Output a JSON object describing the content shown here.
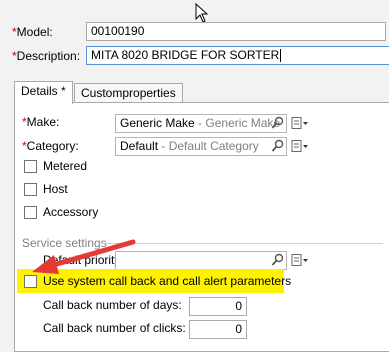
{
  "header": {
    "model_label": "Model:",
    "model_value": "00100190",
    "description_label": "Description:",
    "description_value": "MITA 8020 BRIDGE FOR SORTER"
  },
  "tabs": [
    {
      "label": "Details *",
      "active": true
    },
    {
      "label": "Customproperties",
      "active": false
    }
  ],
  "details": {
    "make_label": "Make:",
    "make_value": "Generic Make",
    "make_hint": "Generic Make",
    "category_label": "Category:",
    "category_value": "Default",
    "category_hint": "Default Category",
    "checkboxes": [
      {
        "label": "Metered",
        "checked": false
      },
      {
        "label": "Host",
        "checked": false
      },
      {
        "label": "Accessory",
        "checked": false
      }
    ]
  },
  "service_settings": {
    "section_label": "Service settings",
    "default_priority_label": "Default priority:",
    "default_priority_value": "",
    "use_system_label": "Use system call back and call alert parameters",
    "use_system_checked": false,
    "callback_days_label": "Call back number of days:",
    "callback_days_value": "0",
    "callback_clicks_label": "Call back number of clicks:",
    "callback_clicks_value": "0"
  },
  "annotation": {
    "highlight_color": "#fff200",
    "arrow_color": "#e53935"
  }
}
